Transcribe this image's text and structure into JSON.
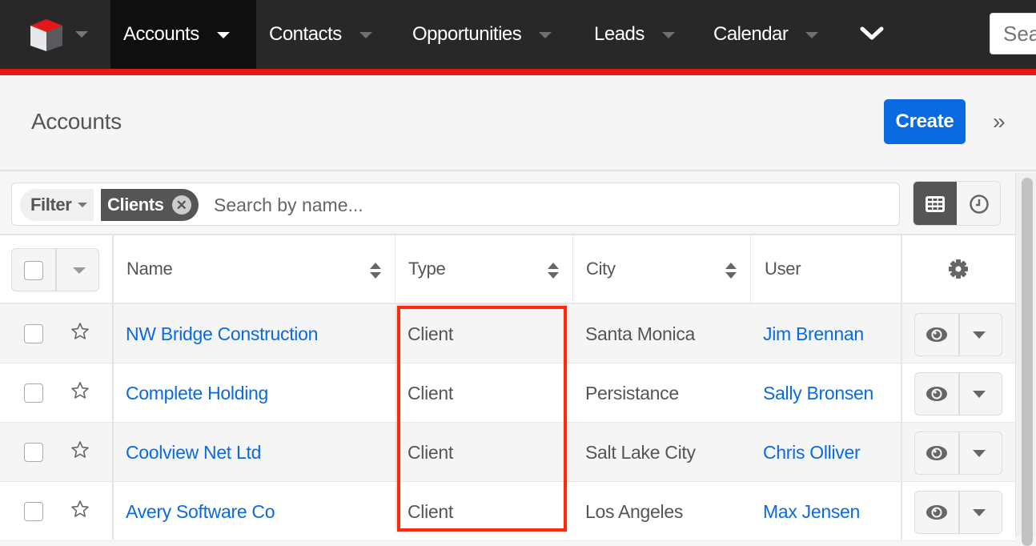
{
  "nav": {
    "items": [
      {
        "label": "Accounts",
        "active": true
      },
      {
        "label": "Contacts",
        "active": false
      },
      {
        "label": "Opportunities",
        "active": false
      },
      {
        "label": "Leads",
        "active": false
      },
      {
        "label": "Calendar",
        "active": false
      }
    ],
    "search_placeholder": "Search"
  },
  "header": {
    "title": "Accounts",
    "create_label": "Create",
    "expand_icon": "double-chevron-right-icon"
  },
  "filter": {
    "filter_label": "Filter",
    "active_filter": "Clients",
    "clear_icon": "close-circle-icon",
    "search_placeholder": "Search by name..."
  },
  "view_toggle": {
    "list_icon": "table-grid-icon",
    "activity_icon": "clock-icon",
    "active": "list"
  },
  "table": {
    "columns": [
      "Name",
      "Type",
      "City",
      "User"
    ],
    "settings_icon": "gear-icon",
    "rows": [
      {
        "name": "NW Bridge Construction",
        "type": "Client",
        "city": "Santa Monica",
        "user": "Jim Brennan"
      },
      {
        "name": "Complete Holding",
        "type": "Client",
        "city": "Persistance",
        "user": "Sally Bronsen"
      },
      {
        "name": "Coolview Net Ltd",
        "type": "Client",
        "city": "Salt Lake City",
        "user": "Chris Olliver"
      },
      {
        "name": "Avery Software Co",
        "type": "Client",
        "city": "Los Angeles",
        "user": "Max Jensen"
      }
    ]
  },
  "colors": {
    "accent_red": "#e61718",
    "primary_blue": "#0a6ae2",
    "highlight": "#ff2a0a"
  }
}
